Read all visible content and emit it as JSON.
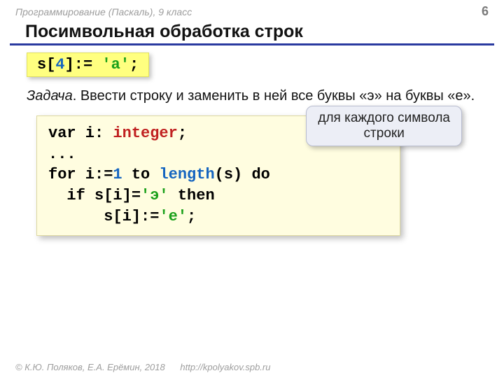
{
  "header": {
    "course": "Программирование (Паскаль), 9 класс",
    "page": "6"
  },
  "title": "Посимвольная обработка строк",
  "snippet1": {
    "p1": "s[",
    "idx": "4",
    "p2": "]:= ",
    "lit": "'a'",
    "p3": ";"
  },
  "task": {
    "label": "Задача",
    "text": ". Ввести строку и заменить в ней все буквы «э» на буквы «е»."
  },
  "code": {
    "l1a": "var i: ",
    "l1b": "integer",
    "l1c": ";",
    "l2": "...",
    "l3a": "for i:=",
    "l3b": "1",
    "l3c": " to ",
    "l3d": "length",
    "l3e": "(s) do",
    "l4a": "  if s[i]=",
    "l4b": "'э'",
    "l4c": " then",
    "l5a": "      s[i]:=",
    "l5b": "'е'",
    "l5c": ";"
  },
  "callout": {
    "line1": "для каждого символа",
    "line2": "строки"
  },
  "footer": {
    "authors": "© К.Ю. Поляков, Е.А. Ерёмин, 2018",
    "url": "http://kpolyakov.spb.ru"
  }
}
